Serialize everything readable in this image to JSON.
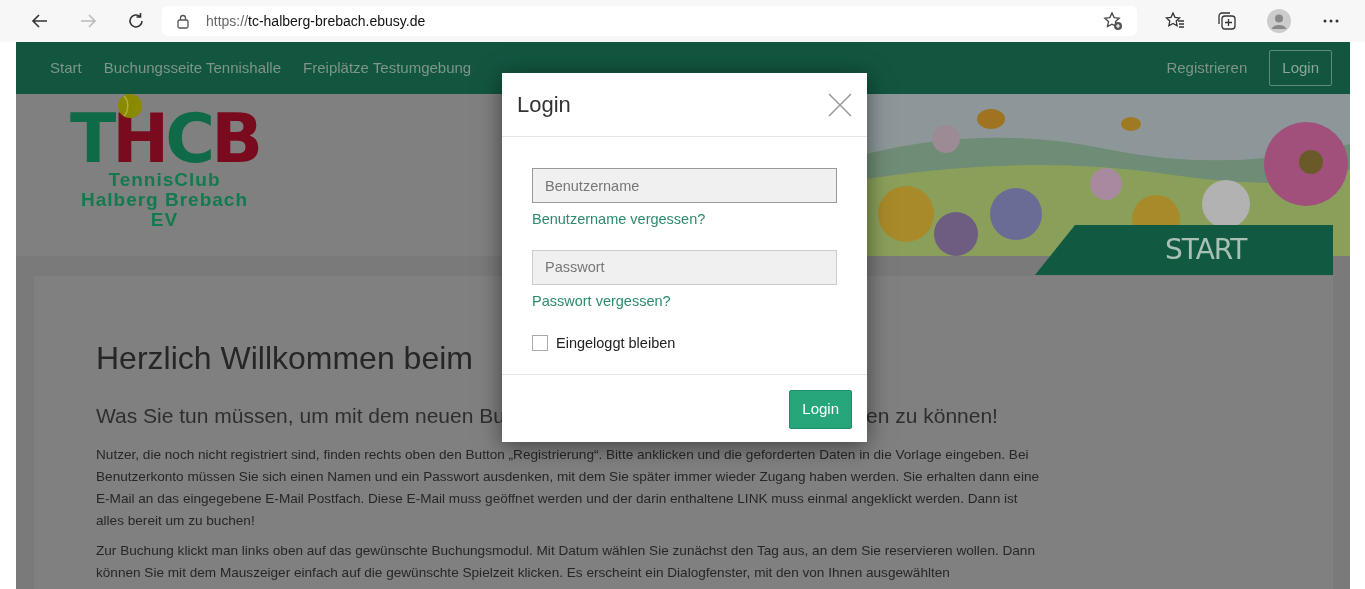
{
  "browser": {
    "back": {
      "disabled": false
    },
    "forward": {
      "disabled": true
    },
    "url_scheme": "https://",
    "url_host": "tc-halberg-brebach.ebusy.de"
  },
  "nav": {
    "links": [
      {
        "label": "Start"
      },
      {
        "label": "Buchungsseite Tennishalle"
      },
      {
        "label": "Freiplätze Testumgebung"
      }
    ],
    "register": "Registrieren",
    "login": "Login"
  },
  "logo": {
    "mark": "THCB",
    "line_1": "TennisClub",
    "line_2": "Halberg Brebach",
    "line_3": "EV"
  },
  "banner": {
    "kind": "picture",
    "tab": "START"
  },
  "content": {
    "heading": "Herzlich Willkommen beim",
    "subheading_left": "Was Sie tun müssen, um mit dem neuen Bu",
    "subheading_right": "en zu können!",
    "paragraphs": [
      "Nutzer, die noch nicht registriert sind, finden rechts oben den Button „Registrierung“. Bitte anklicken und die geforderten Daten in die Vorlage eingeben. Bei Benutzerkonto müssen Sie sich einen Namen und ein Passwort ausdenken, mit dem Sie später immer wieder Zugang haben werden. Sie erhalten dann eine E-Mail an das eingegebene E-Mail Postfach. Diese E-Mail muss geöffnet werden und der darin enthaltene LINK muss einmal angeklickt werden. Dann ist alles bereit um zu buchen!",
      "Zur Buchung klickt man links oben auf das gewünschte Buchungsmodul. Mit Datum wählen Sie zunächst den Tag aus, an dem Sie reservieren wollen. Dann können Sie mit dem Mauszeiger einfach auf die gewünschte Spielzeit klicken. Es erscheint ein Dialogfenster, mit den von Ihnen ausgewählten"
    ]
  },
  "modal": {
    "title": "Login",
    "username": {
      "placeholder": "Benutzername"
    },
    "forgot_username": "Benutzername vergessen?",
    "password": {
      "placeholder": "Passwort"
    },
    "forgot_password": "Passwort vergessen?",
    "remember": {
      "label": "Eingeloggt bleiben",
      "checked": false
    },
    "submit": "Login"
  }
}
